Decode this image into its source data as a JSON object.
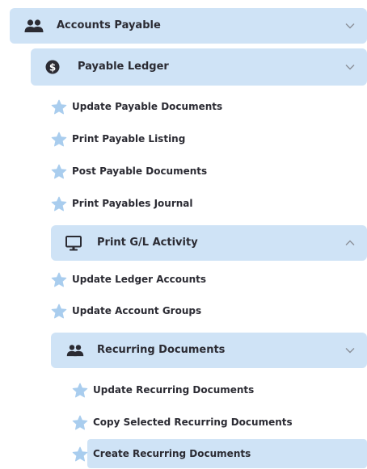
{
  "tree": {
    "accounts_payable": {
      "label": "Accounts Payable",
      "icon": "users-icon",
      "expanded": true
    },
    "payable_ledger": {
      "label": "Payable Ledger",
      "icon": "dollar-circle-icon",
      "expanded": true,
      "items": [
        {
          "label": "Update Payable Documents",
          "icon": "star-icon"
        },
        {
          "label": "Print Payable Listing",
          "icon": "star-icon"
        },
        {
          "label": "Post Payable Documents",
          "icon": "star-icon"
        },
        {
          "label": "Print Payables Journal",
          "icon": "star-icon"
        }
      ]
    },
    "print_gl_activity": {
      "label": "Print G/L Activity",
      "icon": "monitor-icon",
      "expanded": false,
      "items": [
        {
          "label": "Update Ledger Accounts",
          "icon": "star-icon"
        },
        {
          "label": "Update Account Groups",
          "icon": "star-icon"
        }
      ]
    },
    "recurring_documents": {
      "label": "Recurring Documents",
      "icon": "users-icon",
      "expanded": true,
      "items": [
        {
          "label": "Update Recurring Documents",
          "icon": "star-icon"
        },
        {
          "label": "Copy Selected Recurring Documents",
          "icon": "star-icon"
        },
        {
          "label": "Create Recurring Documents",
          "icon": "star-icon",
          "selected": true
        }
      ]
    }
  },
  "colors": {
    "group_bg": "#cfe3f6",
    "star": "#a9cdee",
    "text": "#2b2b33",
    "chevron": "#8a8f98"
  }
}
